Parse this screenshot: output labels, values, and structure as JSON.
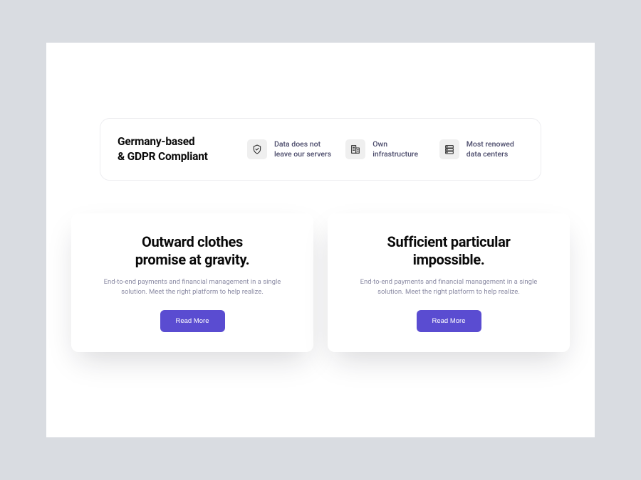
{
  "compliance": {
    "title_line1": "Germany-based",
    "title_line2": "& GDPR Compliant",
    "features": [
      {
        "icon": "shield",
        "text": "Data does not leave our servers"
      },
      {
        "icon": "building",
        "text": "Own infrastructure"
      },
      {
        "icon": "servers",
        "text": "Most renowed data centers"
      }
    ]
  },
  "cards": [
    {
      "title_line1": "Outward clothes",
      "title_line2": "promise at gravity.",
      "desc": "End-to-end payments and financial management in a single solution. Meet the right platform to help realize.",
      "button": "Read More"
    },
    {
      "title_line1": "Sufficient particular",
      "title_line2": "impossible.",
      "desc": "End-to-end payments and financial management in a single solution. Meet the right platform to help realize.",
      "button": "Read More"
    }
  ]
}
